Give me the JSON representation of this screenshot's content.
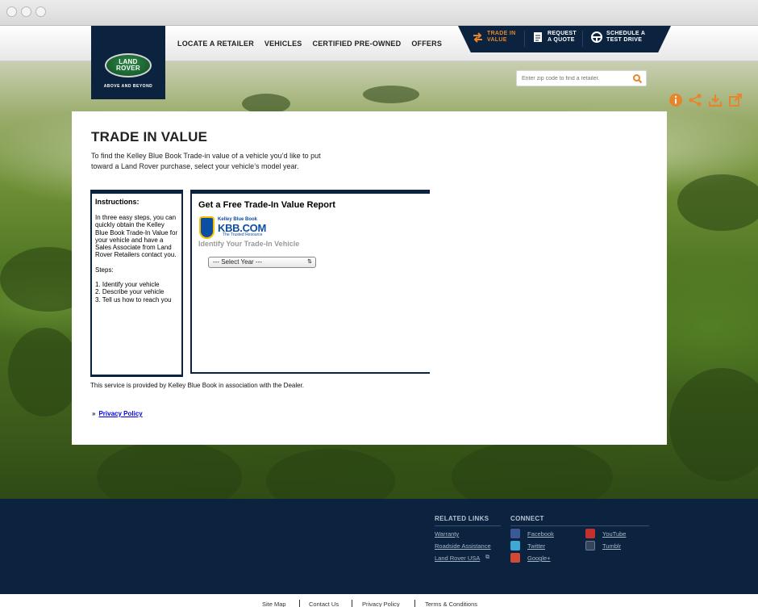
{
  "nav": {
    "items": [
      "LOCATE A RETAILER",
      "VEHICLES",
      "CERTIFIED PRE-OWNED",
      "OFFERS"
    ]
  },
  "logo": {
    "text": "LAND ROVER",
    "tagline": "ABOVE AND BEYOND"
  },
  "cta": {
    "trade_in": "TRADE IN VALUE",
    "request_quote": "REQUEST A QUOTE",
    "test_drive": "SCHEDULE A TEST DRIVE"
  },
  "search": {
    "placeholder": "Enter zip code to find a retailer."
  },
  "colors": {
    "brand_navy": "#0c2340",
    "accent_orange": "#e8842a"
  },
  "page": {
    "title": "TRADE IN VALUE",
    "intro": "To find the Kelley Blue Book Trade-in value of a vehicle you’d like to put toward a Land Rover purchase, select your vehicle’s model year."
  },
  "instructions": {
    "heading": "Instructions:",
    "body": "In three easy steps, you can quickly obtain the Kelley Blue Book Trade-In Value for your vehicle and have a Sales Associate from Land Rover Retailers contact you.",
    "steps_label": "Steps:",
    "steps": [
      "1. Identify your vehicle",
      "2. Describe your vehicle",
      "3. Tell us how to reach you"
    ]
  },
  "report": {
    "heading": "Get a Free Trade-In Value Report",
    "kbb_line1": "Kelley Blue Book",
    "kbb_line2": "KBB.COM",
    "kbb_line3": "The Trusted Resource",
    "identify": "Identify Your Trade-In Vehicle",
    "select_value": "--- Select Year ---"
  },
  "service_note": "This service is provided by Kelley Blue Book in association with the Dealer.",
  "privacy": {
    "chevron": "»",
    "link": "Privacy Policy"
  },
  "footer": {
    "related_title": "RELATED LINKS",
    "related": [
      "Warranty",
      "Roadside Assistance",
      "Land Rover USA"
    ],
    "connect_title": "CONNECT",
    "social": [
      "Facebook",
      "Twitter",
      "Google+",
      "YouTube",
      "Tumblr"
    ]
  },
  "bottom": {
    "links": [
      "Site Map",
      "Contact Us",
      "Privacy Policy",
      "Terms & Conditions"
    ]
  }
}
